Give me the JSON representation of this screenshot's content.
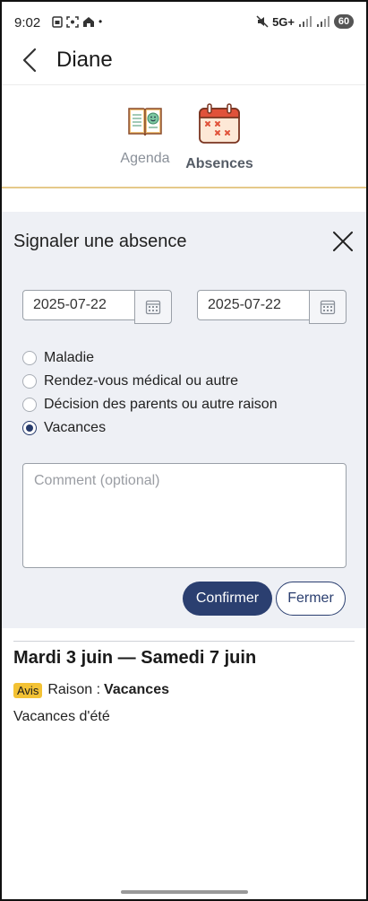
{
  "status_bar": {
    "time": "9:02",
    "dot": "•",
    "network": "5G+",
    "battery": "60"
  },
  "header": {
    "title": "Diane"
  },
  "tabs": [
    {
      "label": "Agenda",
      "icon": "book-smiley-icon",
      "active": false
    },
    {
      "label": "Absences",
      "icon": "calendar-x-icon",
      "active": true
    }
  ],
  "form": {
    "title": "Signaler une absence",
    "start_date": "2025-07-22",
    "end_date": "2025-07-22",
    "reasons": [
      {
        "label": "Maladie",
        "checked": false
      },
      {
        "label": "Rendez-vous médical ou autre",
        "checked": false
      },
      {
        "label": "Décision des parents ou autre raison",
        "checked": false
      },
      {
        "label": "Vacances",
        "checked": true
      }
    ],
    "comment_placeholder": "Comment (optional)",
    "confirm_label": "Confirmer",
    "close_label": "Fermer"
  },
  "record": {
    "title": "Mardi 3 juin — Samedi 7 juin",
    "badge": "Avis",
    "reason_prefix": "Raison :",
    "reason_value": "Vacances",
    "description": "Vacances d'été"
  },
  "colors": {
    "primary": "#2b3f70",
    "badge": "#f3c234",
    "panel_bg": "#eef0f5",
    "tab_underline": "#e5c98a"
  }
}
